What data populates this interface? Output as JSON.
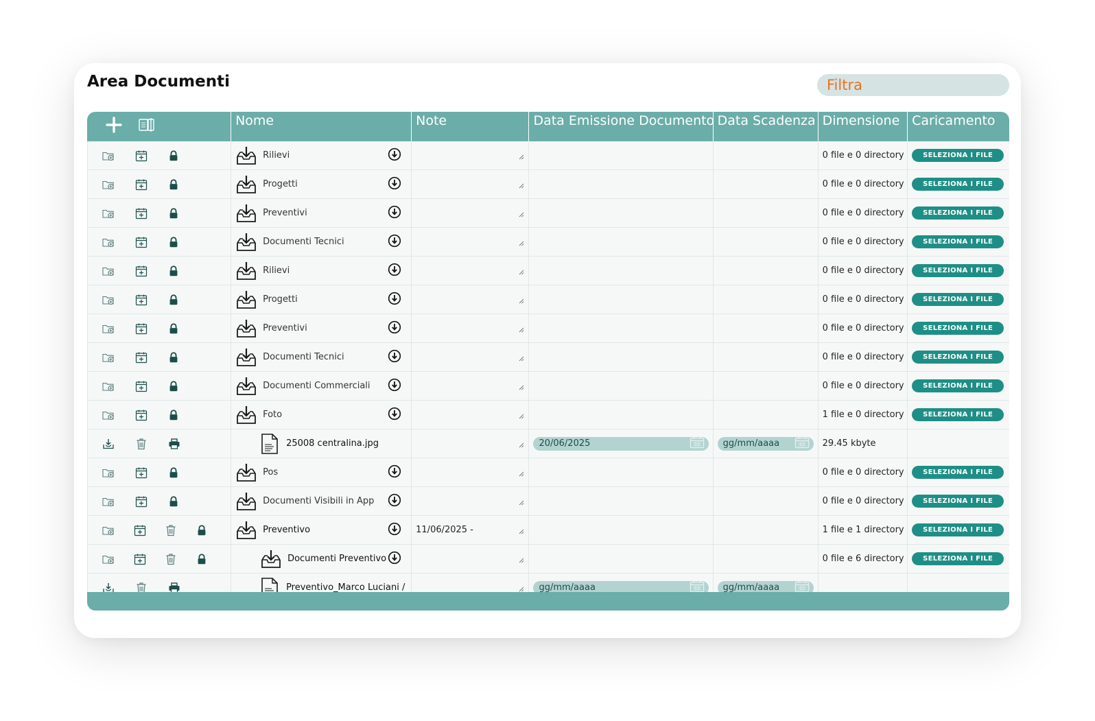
{
  "page": {
    "title": "Area Documenti"
  },
  "filter": {
    "placeholder": "Filtra"
  },
  "colors": {
    "header": "#6aada9",
    "button": "#1e8f86",
    "filter_text": "#e8731e",
    "date_pill": "#b3d3d1",
    "icon_dark": "#1b4e4a"
  },
  "columns": {
    "nome": "Nome",
    "note": "Note",
    "data_emissione": "Data Emissione Documento",
    "data_scadenza": "Data Scadenza",
    "dimensione": "Dimensione",
    "caricamento": "Caricamento"
  },
  "header_icons": [
    "plus-icon",
    "columns-toggle-icon"
  ],
  "button_label": "SELEZIONA I FILE",
  "rows": [
    {
      "type": "folder",
      "name": "Rilievi",
      "note": "",
      "emission": "",
      "expiry": "",
      "size": "0 file e 0 directory",
      "actions": [
        "add-folder",
        "calendar",
        "lock"
      ]
    },
    {
      "type": "folder",
      "name": "Progetti",
      "note": "",
      "emission": "",
      "expiry": "",
      "size": "0 file e 0 directory",
      "actions": [
        "add-folder",
        "calendar",
        "lock"
      ]
    },
    {
      "type": "folder",
      "name": "Preventivi",
      "note": "",
      "emission": "",
      "expiry": "",
      "size": "0 file e 0 directory",
      "actions": [
        "add-folder",
        "calendar",
        "lock"
      ]
    },
    {
      "type": "folder",
      "name": "Documenti Tecnici",
      "note": "",
      "emission": "",
      "expiry": "",
      "size": "0 file e 0 directory",
      "actions": [
        "add-folder",
        "calendar",
        "lock"
      ]
    },
    {
      "type": "folder",
      "name": "Rilievi",
      "note": "",
      "emission": "",
      "expiry": "",
      "size": "0 file e 0 directory",
      "actions": [
        "add-folder",
        "calendar",
        "lock"
      ]
    },
    {
      "type": "folder",
      "name": "Progetti",
      "note": "",
      "emission": "",
      "expiry": "",
      "size": "0 file e 0 directory",
      "actions": [
        "add-folder",
        "calendar",
        "lock"
      ]
    },
    {
      "type": "folder",
      "name": "Preventivi",
      "note": "",
      "emission": "",
      "expiry": "",
      "size": "0 file e 0 directory",
      "actions": [
        "add-folder",
        "calendar",
        "lock"
      ]
    },
    {
      "type": "folder",
      "name": "Documenti Tecnici",
      "note": "",
      "emission": "",
      "expiry": "",
      "size": "0 file e 0 directory",
      "actions": [
        "add-folder",
        "calendar",
        "lock"
      ]
    },
    {
      "type": "folder",
      "name": "Documenti Commerciali",
      "note": "",
      "emission": "",
      "expiry": "",
      "size": "0 file e 0 directory",
      "actions": [
        "add-folder",
        "calendar",
        "lock"
      ]
    },
    {
      "type": "folder",
      "name": "Foto",
      "note": "",
      "emission": "",
      "expiry": "",
      "size": "1 file e 0 directory",
      "actions": [
        "add-folder",
        "calendar",
        "lock"
      ]
    },
    {
      "type": "file",
      "name": "25008 centralina.jpg",
      "note": "",
      "emission": "20/06/2025",
      "expiry": "gg/mm/aaaa",
      "size": "29.45 kbyte",
      "actions": [
        "download",
        "trash",
        "print"
      ]
    },
    {
      "type": "folder",
      "name": "Pos",
      "note": "",
      "emission": "",
      "expiry": "",
      "size": "0 file e 0 directory",
      "actions": [
        "add-folder",
        "calendar",
        "lock"
      ]
    },
    {
      "type": "folder",
      "name": "Documenti Visibili in App",
      "note": "",
      "emission": "",
      "expiry": "",
      "size": "0 file e 0 directory",
      "actions": [
        "add-folder",
        "calendar",
        "lock"
      ]
    },
    {
      "type": "folder",
      "name": "Preventivo",
      "note": "11/06/2025 -",
      "emission": "",
      "expiry": "",
      "size": "1 file e 1 directory",
      "actions": [
        "add-folder",
        "calendar",
        "trash",
        "lock"
      ],
      "dark": true
    },
    {
      "type": "folder",
      "name": "Documenti Preventivo",
      "note": "",
      "emission": "",
      "expiry": "",
      "size": "0 file e 6 directory",
      "actions": [
        "add-folder",
        "calendar",
        "trash",
        "lock"
      ],
      "indent": true,
      "dark": true
    },
    {
      "type": "file",
      "name": "Preventivo_Marco Luciani /",
      "note": "",
      "emission": "gg/mm/aaaa",
      "expiry": "gg/mm/aaaa",
      "size": "",
      "actions": [
        "download",
        "trash",
        "print"
      ]
    }
  ]
}
